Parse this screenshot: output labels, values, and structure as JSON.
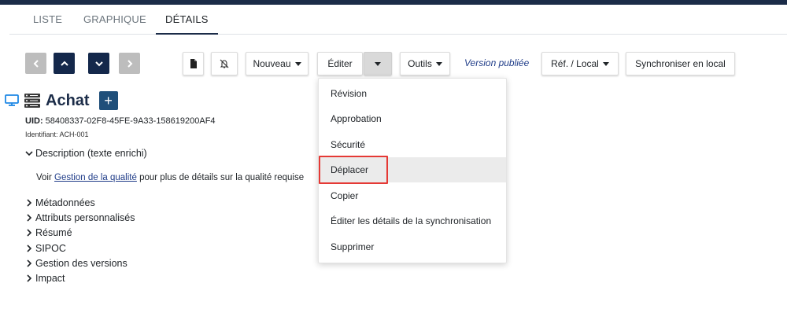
{
  "tabs": {
    "liste": "LISTE",
    "graphique": "GRAPHIQUE",
    "details": "DÉTAILS"
  },
  "toolbar": {
    "nouveau": "Nouveau",
    "editer": "Éditer",
    "outils": "Outils",
    "version": "Version publiée",
    "ref_local": "Réf. / Local",
    "sync": "Synchroniser en local"
  },
  "record": {
    "title": "Achat",
    "add_symbol": "+",
    "uid_label": "UID:",
    "uid_value": "58408337-02F8-45FE-9A33-158619200AF4",
    "ident_label": "Identifiant:",
    "ident_value": "ACH-001"
  },
  "sections": {
    "description": "Description (texte enrichi)",
    "desc_prefix": "Voir",
    "desc_link": "Gestion de la qualité",
    "desc_suffix": "pour plus de détails sur la qualité requise",
    "metadonnees": "Métadonnées",
    "attributs": "Attributs personnalisés",
    "resume": "Résumé",
    "sipoc": "SIPOC",
    "versions": "Gestion des versions",
    "impact": "Impact"
  },
  "menu": {
    "items": [
      "Révision",
      "Approbation",
      "Sécurité",
      "Déplacer",
      "Copier",
      "Éditer les détails de la synchronisation",
      "Supprimer"
    ],
    "highlighted": "Déplacer"
  },
  "colors": {
    "navy": "#14284b",
    "accent": "#1f3c88",
    "highlight_border": "#e53935"
  }
}
